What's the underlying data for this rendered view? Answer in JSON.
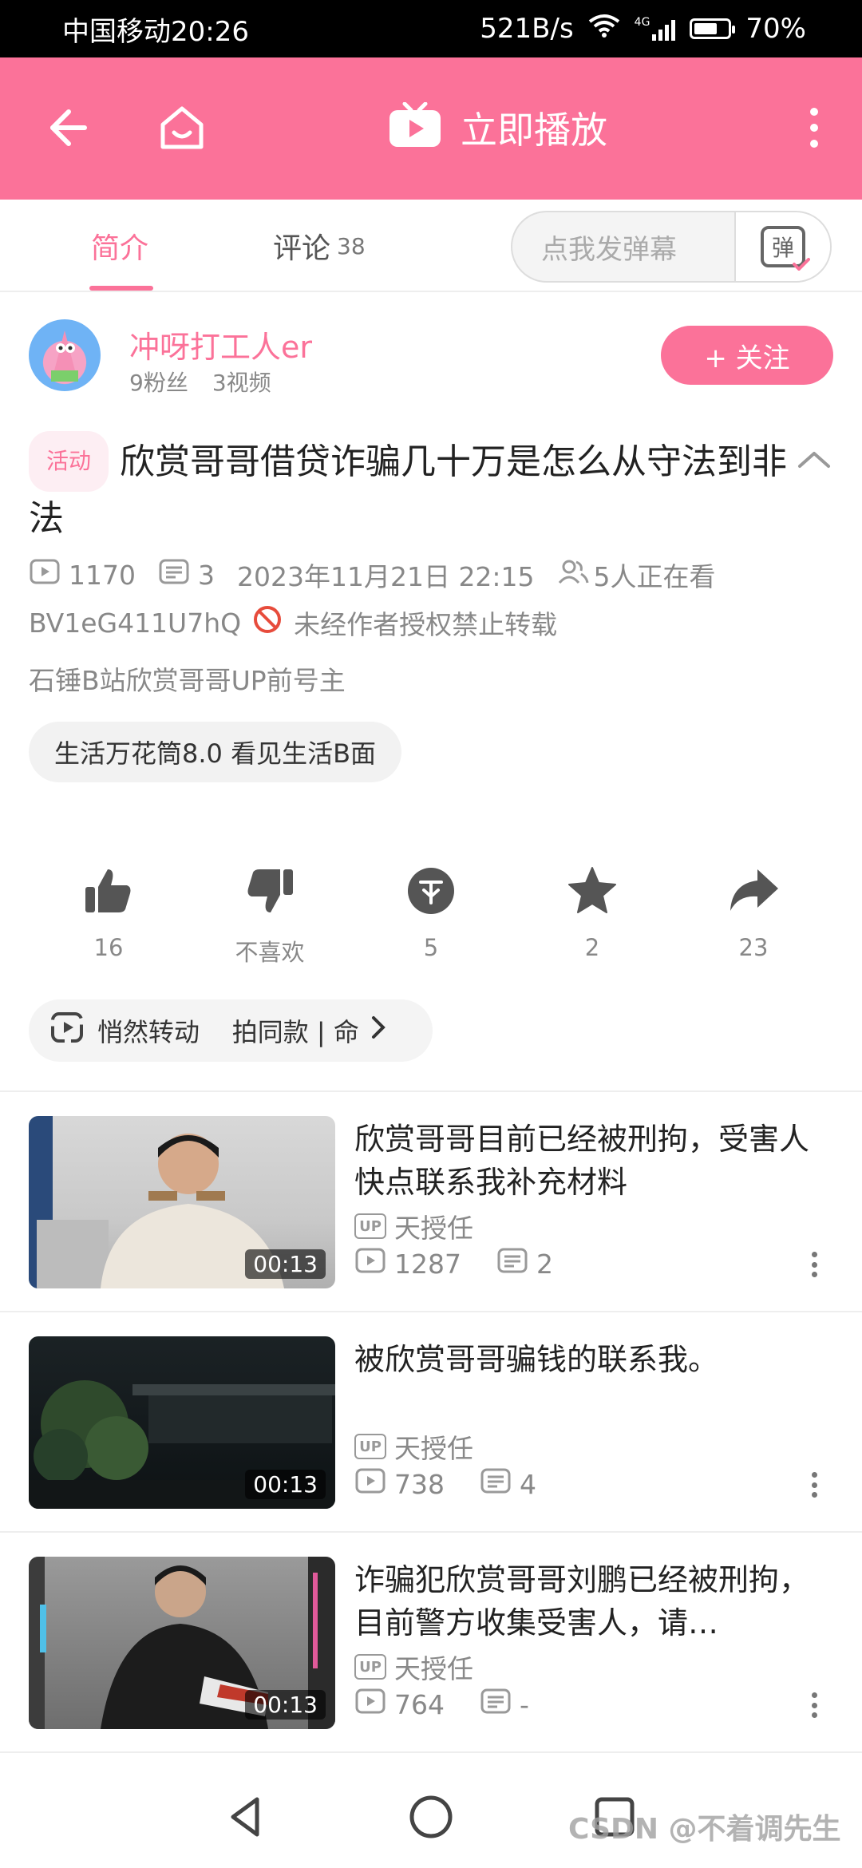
{
  "status_bar": {
    "carrier_time": "中国移动20:26",
    "net_speed": "521B/s",
    "signal_label": "4G",
    "battery_percent": "70%",
    "battery_level": 0.7
  },
  "header": {
    "title": "立即播放",
    "accent_color": "#fb7299"
  },
  "tabs": {
    "intro_label": "简介",
    "comments_label": "评论",
    "comments_count": "38",
    "danmaku_placeholder": "点我发弹幕",
    "danmaku_button_glyph": "弹"
  },
  "uploader": {
    "name": "冲呀打工人er",
    "fans": "9粉丝",
    "videos": "3视频",
    "follow_label": "+ 关注"
  },
  "video": {
    "tag": "活动",
    "title": "欣赏哥哥借贷诈骗几十万是怎么从守法到非法",
    "views": "1170",
    "danmaku_count": "3",
    "datetime": "2023年11月21日 22:15",
    "watching": "5人正在看",
    "bvid": "BV1eG411U7hQ",
    "repost_notice": "未经作者授权禁止转载",
    "description": "石锤B站欣赏哥哥UP前号主",
    "topic": "生活万花筒8.0 看见生活B面"
  },
  "actions": {
    "like": "16",
    "dislike": "不喜欢",
    "coin": "5",
    "favorite": "2",
    "share": "23"
  },
  "music": {
    "text": "悄然转动    拍同款 | 命"
  },
  "related": [
    {
      "title": "欣赏哥哥目前已经被刑拘，受害人快点联系我补充材料",
      "up_name": "天授任",
      "views": "1287",
      "danmaku": "2",
      "duration": "00:13"
    },
    {
      "title": "被欣赏哥哥骗钱的联系我。",
      "up_name": "天授任",
      "views": "738",
      "danmaku": "4",
      "duration": "00:13"
    },
    {
      "title": "诈骗犯欣赏哥哥刘鹏已经被刑拘，目前警方收集受害人，请…",
      "up_name": "天授任",
      "views": "764",
      "danmaku": "-",
      "duration": "00:13"
    }
  ],
  "up_badge_text": "UP",
  "watermark": "CSDN @不着调先生"
}
